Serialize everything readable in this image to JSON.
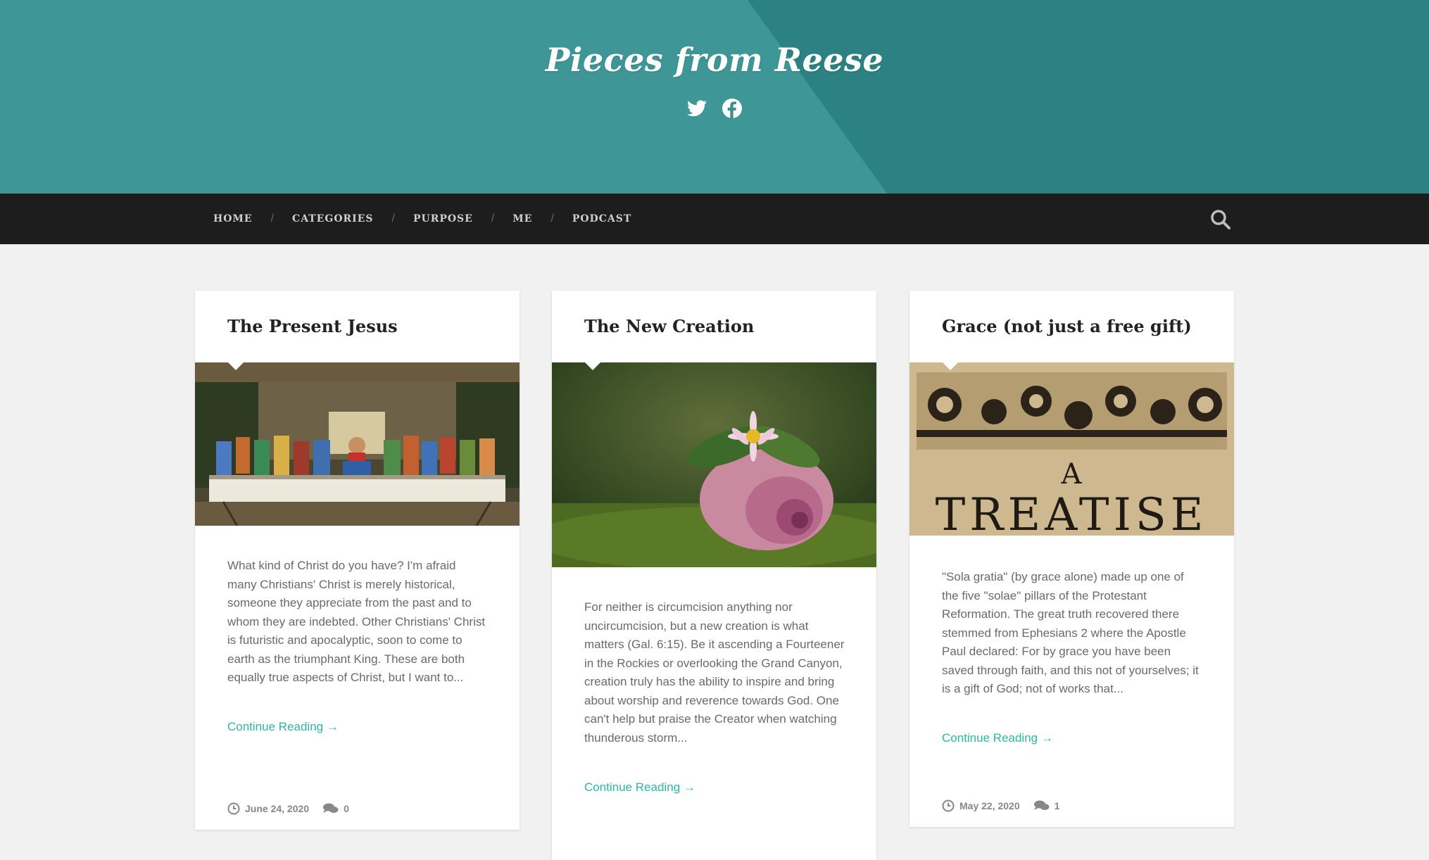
{
  "site": {
    "title": "Pieces from Reese",
    "social": [
      {
        "name": "twitter-icon"
      },
      {
        "name": "facebook-icon"
      }
    ],
    "colors": {
      "header": "#3f9696",
      "header_dark": "#2b8080",
      "nav": "#1d1d1d",
      "accent": "#2bb7a8"
    }
  },
  "nav": {
    "items": [
      "HOME",
      "CATEGORIES",
      "PURPOSE",
      "ME",
      "PODCAST"
    ],
    "separator": "/",
    "search_icon": "search-icon"
  },
  "posts": [
    {
      "title": "The Present Jesus",
      "image": "last-supper painting",
      "excerpt": "What kind of Christ do you have? I'm afraid many Christians' Christ is merely historical, someone they appreciate from the past and to whom they are indebted. Other Christians' Christ is futuristic and apocalyptic, soon to come to earth as the triumphant King. These are both equally true aspects of Christ, but I want to...",
      "continue": "Continue Reading →",
      "date": "June 24, 2020",
      "comments": "0"
    },
    {
      "title": "The New Creation",
      "image": "flower in seashell",
      "excerpt": "For neither is circumcision anything nor uncircumcision, but a new creation is what matters (Gal. 6:15). Be it ascending a Fourteener in the Rockies or overlooking the Grand Canyon, creation truly has the ability to inspire and bring about worship and reverence towards God. One can't help but praise the Creator when watching thunderous storm...",
      "continue": "Continue Reading →"
    },
    {
      "title": "Grace (not just a free gift)",
      "image": "old treatise title page",
      "image_text_a": "A",
      "image_text_b": "TREATISE",
      "excerpt": "\"Sola gratia\" (by grace alone) made up one of the five \"solae\" pillars of the Protestant Reformation. The great truth recovered there stemmed from Ephesians 2 where the Apostle Paul declared: For by grace you have been saved through faith, and this not of yourselves; it is a gift of God; not of works that...",
      "continue": "Continue Reading →",
      "date": "May 22, 2020",
      "comments": "1"
    }
  ]
}
